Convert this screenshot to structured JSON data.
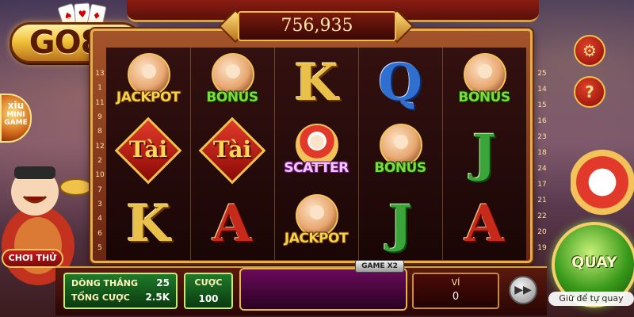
{
  "brand": {
    "logo_text": "GO88"
  },
  "colors": {
    "accent_gold": "#e5b04a",
    "spin_green": "#3a9a1a",
    "frame_red": "#6a2612"
  },
  "win_counter": "756,935",
  "mini_game": {
    "title": "xiu",
    "subtitle": "MINI GAME"
  },
  "try_button": "CHƠI THỬ",
  "reels": [
    [
      {
        "type": "jackpot",
        "label": "JACKPOT"
      },
      {
        "type": "tai",
        "label": "Tài"
      },
      {
        "type": "letter",
        "label": "K",
        "color": "gold"
      }
    ],
    [
      {
        "type": "bonus",
        "label": "BONUS"
      },
      {
        "type": "tai",
        "label": "Tài"
      },
      {
        "type": "letter",
        "label": "A",
        "color": "red"
      }
    ],
    [
      {
        "type": "letter",
        "label": "K",
        "color": "gold"
      },
      {
        "type": "scatter",
        "label": "SCATTER"
      },
      {
        "type": "jackpot",
        "label": "JACKPOT"
      }
    ],
    [
      {
        "type": "letter",
        "label": "Q",
        "color": "blue"
      },
      {
        "type": "bonus",
        "label": "BONUS"
      },
      {
        "type": "letter",
        "label": "J",
        "color": "green"
      }
    ],
    [
      {
        "type": "bonus",
        "label": "BONUS"
      },
      {
        "type": "letter",
        "label": "J",
        "color": "green"
      },
      {
        "type": "letter",
        "label": "A",
        "color": "red"
      }
    ]
  ],
  "line_numbers_left": [
    "13",
    "1",
    "11",
    "9",
    "8",
    "12",
    "2",
    "10",
    "7",
    "3",
    "4",
    "6",
    "5"
  ],
  "line_numbers_right": [
    "25",
    "14",
    "15",
    "16",
    "23",
    "18",
    "24",
    "17",
    "21",
    "22",
    "20",
    "19"
  ],
  "panels": {
    "winning_lines_label": "DÒNG THẮNG",
    "winning_lines_value": "25",
    "total_bet_label": "TỔNG CƯỢC",
    "total_bet_value": "2.5K",
    "bet_label": "CƯỢC",
    "bet_value": "100",
    "game_multiplier": "GAME X2",
    "wallet_label": "VÍ",
    "wallet_value": "0"
  },
  "buttons": {
    "settings_icon": "gear-icon",
    "help_label": "?",
    "spin_label": "QUAY",
    "fast_forward_icon": "fast-forward-icon",
    "autospin_hint": "Giữ để tự quay"
  }
}
